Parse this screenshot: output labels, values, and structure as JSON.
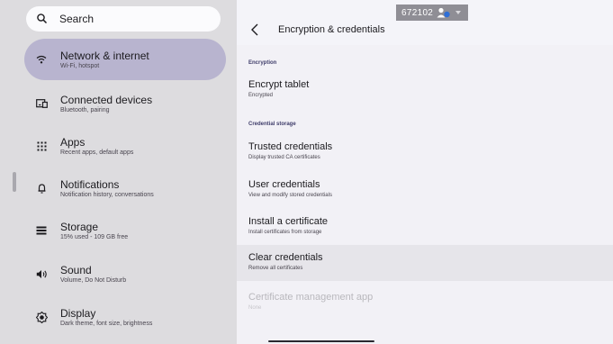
{
  "search": {
    "placeholder": "Search",
    "icon": "search-icon"
  },
  "sidebar": {
    "items": [
      {
        "title": "Network & internet",
        "subtitle": "Wi-Fi, hotspot",
        "icon": "wifi-icon",
        "active": true
      },
      {
        "title": "Connected devices",
        "subtitle": "Bluetooth, pairing",
        "icon": "devices-icon"
      },
      {
        "title": "Apps",
        "subtitle": "Recent apps, default apps",
        "icon": "apps-grid-icon"
      },
      {
        "title": "Notifications",
        "subtitle": "Notification history, conversations",
        "icon": "bell-icon"
      },
      {
        "title": "Storage",
        "subtitle": "15% used - 109 GB free",
        "icon": "storage-icon"
      },
      {
        "title": "Sound",
        "subtitle": "Volume, Do Not Disturb",
        "icon": "volume-icon"
      },
      {
        "title": "Display",
        "subtitle": "Dark theme, font size, brightness",
        "icon": "brightness-icon"
      }
    ],
    "active_color": "#b8b4cf"
  },
  "header": {
    "title": "Encryption & credentials",
    "badge_id": "672102"
  },
  "sections": {
    "encryption": "Encryption",
    "credential_storage": "Credential storage"
  },
  "rows": {
    "encrypt_tablet": {
      "title": "Encrypt tablet",
      "subtitle": "Encrypted"
    },
    "trusted": {
      "title": "Trusted credentials",
      "subtitle": "Display trusted CA certificates"
    },
    "user": {
      "title": "User credentials",
      "subtitle": "View and modify stored credentials"
    },
    "install": {
      "title": "Install a certificate",
      "subtitle": "Install certificates from storage"
    },
    "clear": {
      "title": "Clear credentials",
      "subtitle": "Remove all certificates"
    },
    "cert_app": {
      "title": "Certificate management app",
      "subtitle": "None"
    }
  }
}
